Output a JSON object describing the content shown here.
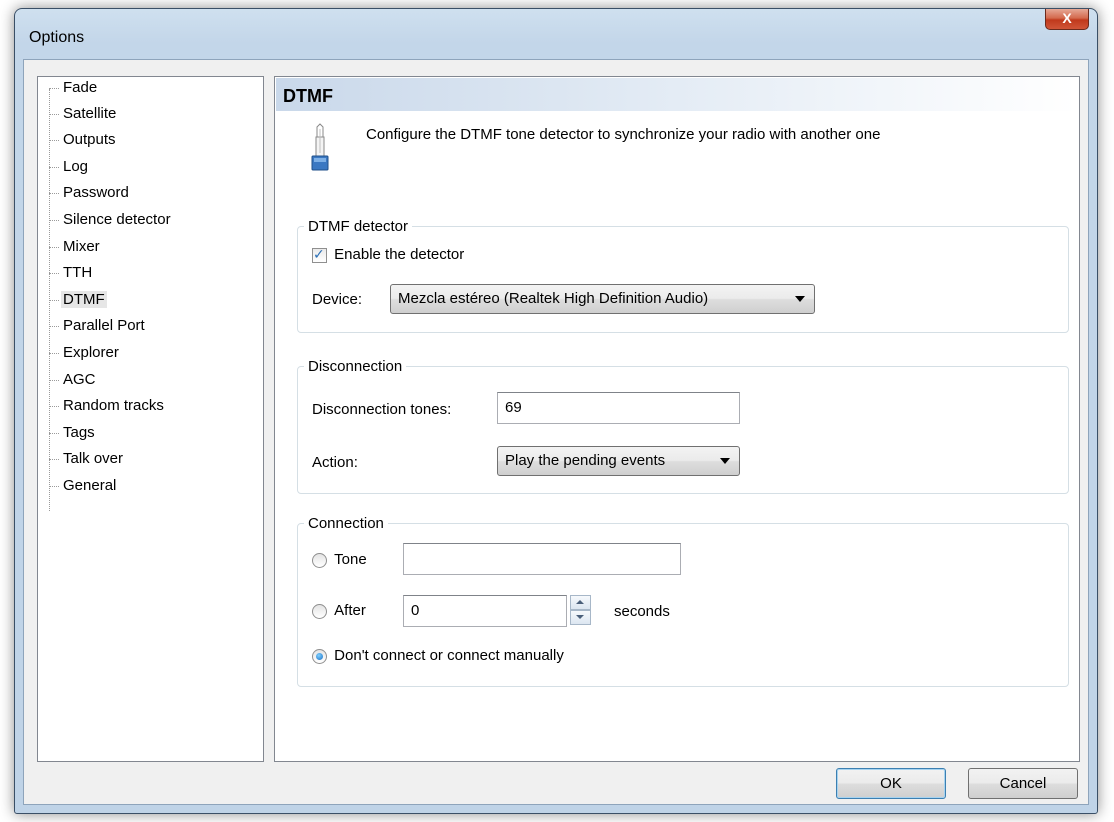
{
  "window": {
    "title": "Options",
    "close_label": "X"
  },
  "tree": {
    "items": [
      "Fade",
      "Satellite",
      "Outputs",
      "Log",
      "Password",
      "Silence detector",
      "Mixer",
      "TTH",
      "DTMF",
      "Parallel Port",
      "Explorer",
      "AGC",
      "Random tracks",
      "Tags",
      "Talk over",
      "General"
    ],
    "selected": "DTMF"
  },
  "page": {
    "header": "DTMF",
    "intro_icon": "jack-plug-icon",
    "intro_text": "Configure the DTMF tone detector to synchronize your radio with another one",
    "detector": {
      "legend": "DTMF detector",
      "enable_label": "Enable the detector",
      "enable_checked": true,
      "device_label": "Device:",
      "device_value": "Mezcla estéreo (Realtek High Definition Audio)"
    },
    "disconnection": {
      "legend": "Disconnection",
      "tones_label": "Disconnection tones:",
      "tones_value": "69",
      "action_label": "Action:",
      "action_value": "Play the pending events"
    },
    "connection": {
      "legend": "Connection",
      "tone_label": "Tone",
      "tone_value": "",
      "after_label": "After",
      "after_value": "0",
      "seconds_label": "seconds",
      "manual_label": "Don't connect or connect manually",
      "selected_option": "manual"
    }
  },
  "buttons": {
    "ok": "OK",
    "cancel": "Cancel"
  },
  "colors": {
    "header_gradient_start": "#c9d8ea",
    "frame": "#bfd3e7",
    "close_red": "#c0391c"
  }
}
